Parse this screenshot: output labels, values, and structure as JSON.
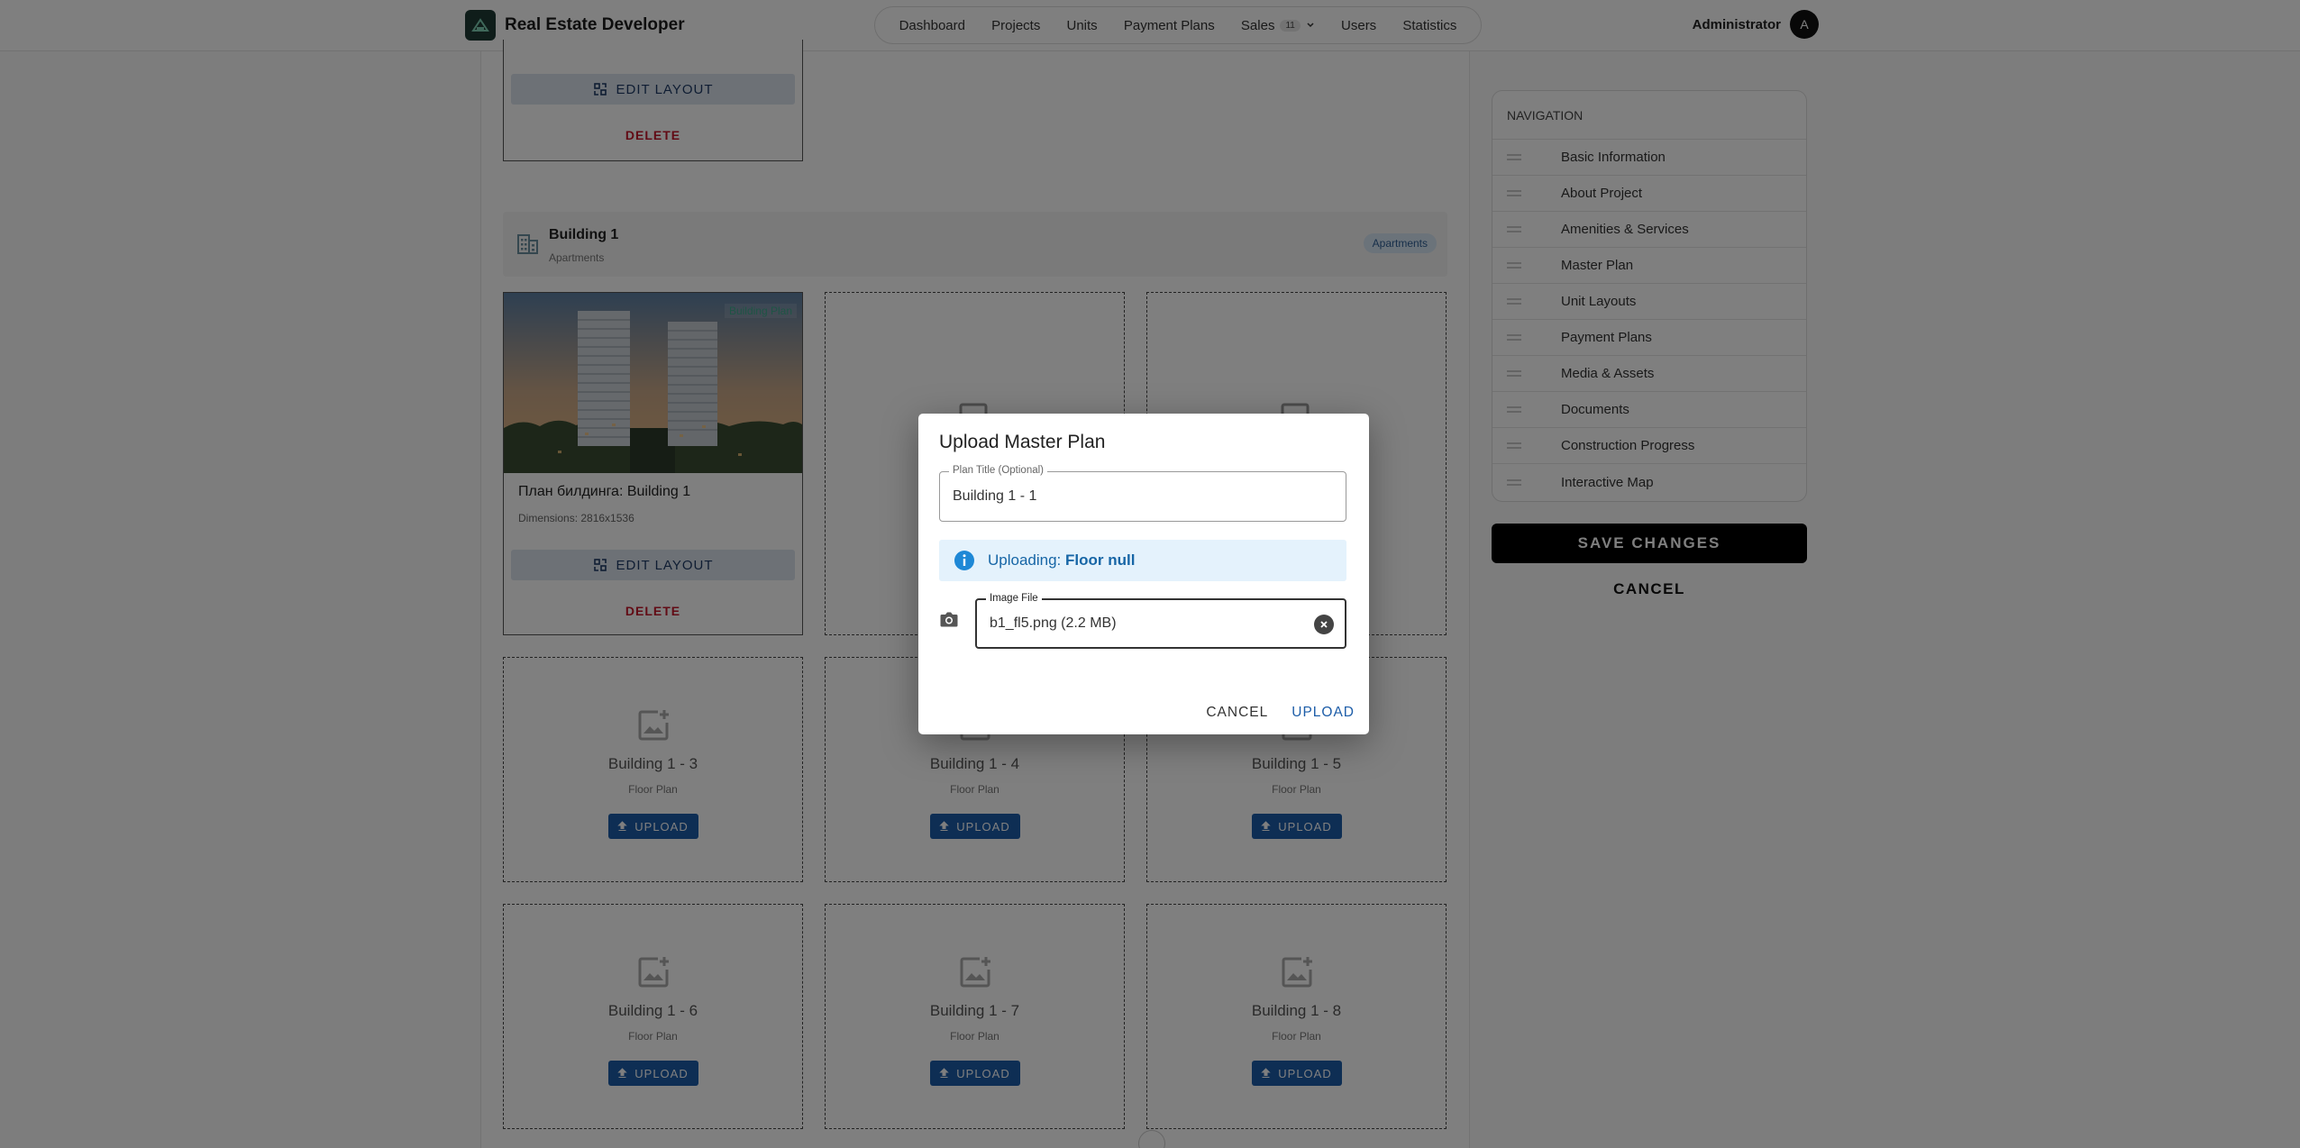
{
  "app": {
    "title": "Real Estate Developer"
  },
  "nav": {
    "links": [
      {
        "label": "Dashboard"
      },
      {
        "label": "Projects"
      },
      {
        "label": "Units"
      },
      {
        "label": "Payment Plans"
      },
      {
        "label": "Sales",
        "badge": "11"
      },
      {
        "label": "Users"
      },
      {
        "label": "Statistics"
      }
    ]
  },
  "user": {
    "name": "Administrator",
    "initial": "A"
  },
  "top_card": {
    "edit_label": "EDIT LAYOUT",
    "delete_label": "DELETE"
  },
  "building": {
    "title": "Building 1",
    "subtitle": "Apartments",
    "chip": "Apartments"
  },
  "plan_card": {
    "tag": "Building Plan",
    "title": "План билдинга: Building 1",
    "dimensions": "Dimensions: 2816x1536",
    "edit_label": "EDIT LAYOUT",
    "delete_label": "DELETE"
  },
  "slots": [
    {
      "title": "Building 1 - 3",
      "sub": "Floor Plan",
      "button": "UPLOAD"
    },
    {
      "title": "Building 1 - 4",
      "sub": "Floor Plan",
      "button": "UPLOAD"
    },
    {
      "title": "Building 1 - 5",
      "sub": "Floor Plan",
      "button": "UPLOAD"
    },
    {
      "title": "Building 1 - 6",
      "sub": "Floor Plan",
      "button": "UPLOAD"
    },
    {
      "title": "Building 1 - 7",
      "sub": "Floor Plan",
      "button": "UPLOAD"
    },
    {
      "title": "Building 1 - 8",
      "sub": "Floor Plan",
      "button": "UPLOAD"
    }
  ],
  "side_nav": {
    "title": "NAVIGATION",
    "items": [
      {
        "label": "Basic Information"
      },
      {
        "label": "About Project"
      },
      {
        "label": "Amenities & Services"
      },
      {
        "label": "Master Plan"
      },
      {
        "label": "Unit Layouts"
      },
      {
        "label": "Payment Plans"
      },
      {
        "label": "Media & Assets"
      },
      {
        "label": "Documents"
      },
      {
        "label": "Construction Progress"
      },
      {
        "label": "Interactive Map"
      }
    ],
    "save_label": "SAVE CHANGES",
    "cancel_label": "CANCEL"
  },
  "dialog": {
    "title": "Upload Master Plan",
    "plan_title_label": "Plan Title (Optional)",
    "plan_title_value": "Building 1 - 1",
    "alert_prefix": "Uploading:",
    "alert_value": "Floor null",
    "file_label": "Image File",
    "file_value": "b1_fl5.png (2.2 MB)",
    "cancel_label": "CANCEL",
    "upload_label": "UPLOAD"
  },
  "colors": {
    "accent": "#1d5da8",
    "danger": "#c4162a",
    "brand": "#1e3b34",
    "info_bg": "#e4f2fc"
  }
}
